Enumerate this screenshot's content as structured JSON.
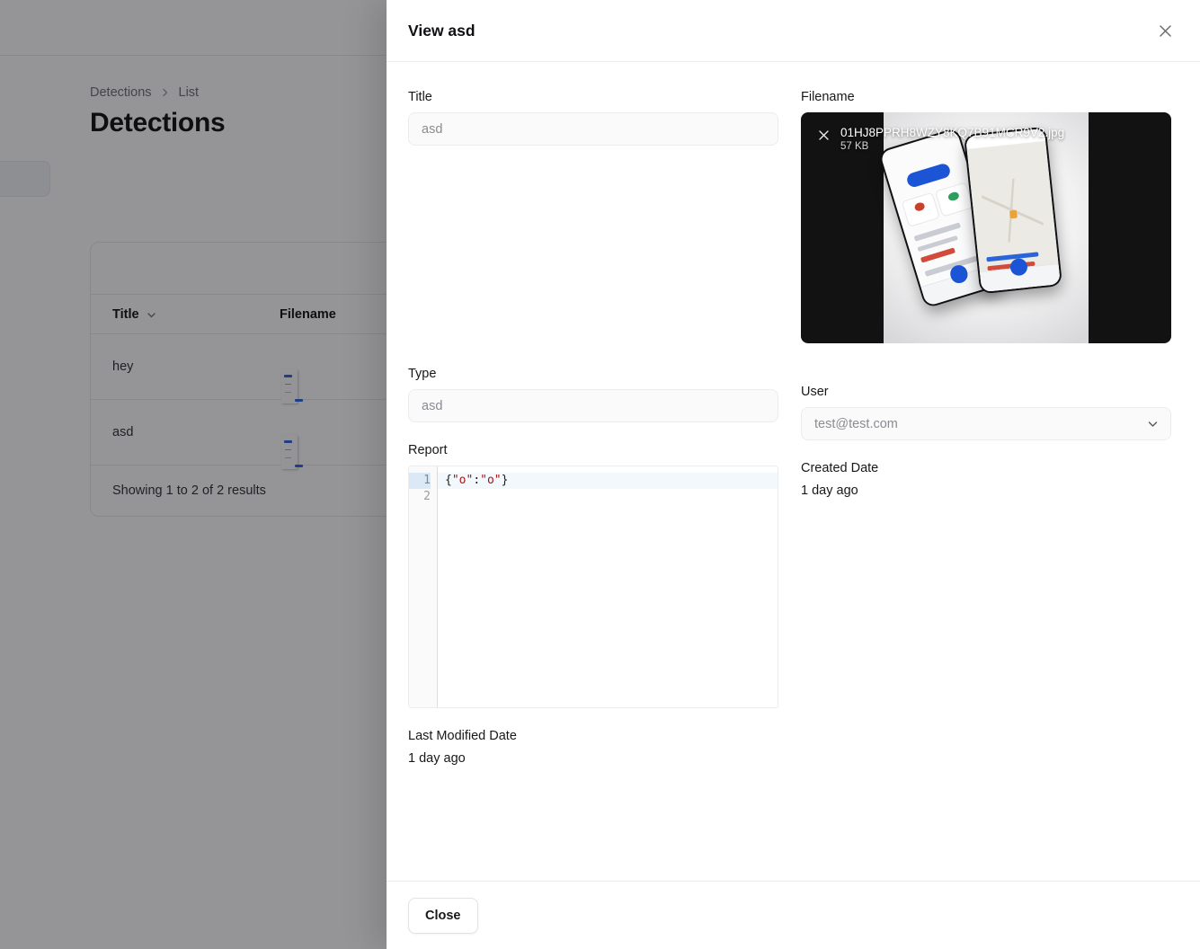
{
  "background": {
    "breadcrumb": {
      "root": "Detections",
      "separator_icon": "chevron-right-icon",
      "current": "List"
    },
    "page_title": "Detections",
    "table": {
      "columns": [
        {
          "label": "Title",
          "sort_icon": "chevron-down-icon"
        },
        {
          "label": "Filename"
        }
      ],
      "rows": [
        {
          "title": "hey",
          "filename_thumb": "image-thumbnail"
        },
        {
          "title": "asd",
          "filename_thumb": "image-thumbnail"
        }
      ],
      "footer": "Showing 1 to 2 of 2 results"
    }
  },
  "modal": {
    "title": "View asd",
    "close_icon": "close-icon",
    "fields": {
      "title": {
        "label": "Title",
        "value": "",
        "placeholder": "asd"
      },
      "type": {
        "label": "Type",
        "value": "",
        "placeholder": "asd"
      },
      "report": {
        "label": "Report",
        "line_numbers": [
          "1",
          "2"
        ],
        "lines": [
          [
            {
              "t": "{",
              "k": "punct"
            },
            {
              "t": "\"o\"",
              "k": "str"
            },
            {
              "t": ":",
              "k": "punct"
            },
            {
              "t": "\"o\"",
              "k": "str"
            },
            {
              "t": "}",
              "k": "punct"
            }
          ],
          []
        ],
        "text": "{\"o\":\"o\"}"
      },
      "last_modified_date": {
        "label": "Last Modified Date",
        "value": "1 day ago"
      },
      "filename": {
        "label": "Filename",
        "file_name": "01HJ8PPRH8WZY8KQ7B91MCR9V2.jpg",
        "file_size": "57 KB",
        "remove_icon": "close-icon",
        "preview_alt": "two-phones-app-screenshot"
      },
      "user": {
        "label": "User",
        "value": "",
        "placeholder": "test@test.com",
        "dropdown_icon": "chevron-down-icon"
      },
      "created_date": {
        "label": "Created Date",
        "value": "1 day ago"
      }
    },
    "footer": {
      "close_label": "Close"
    }
  },
  "colors": {
    "accent": "#1b55d6",
    "overlay": "#8c8c8c",
    "border": "#ececee",
    "input_bg": "#fafafa",
    "code_string": "#a31515",
    "active_line": "#f3f8fd"
  }
}
